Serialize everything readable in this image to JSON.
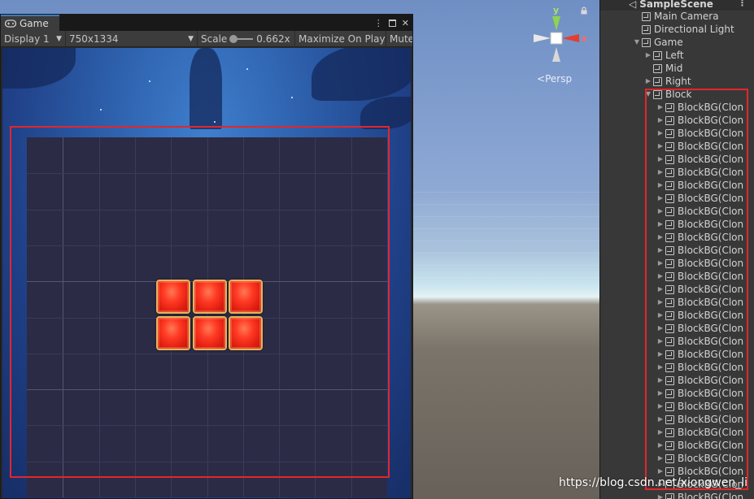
{
  "game_window": {
    "tab_label": "Game",
    "menu_dots": "⋮",
    "close_glyph": "✕",
    "toolbar": {
      "display": "Display 1",
      "resolution": "750x1334",
      "scale_label": "Scale",
      "scale_value": "0.662x",
      "maximize": "Maximize On Play",
      "mute": "Mute"
    }
  },
  "scene_view": {
    "persp_label": "Persp",
    "gizmo_y": "y",
    "gizmo_x": "x"
  },
  "hierarchy": {
    "scene_name": "SampleScene",
    "menu_dots": "⋮",
    "items": [
      {
        "label": "Main Camera",
        "depth": 1,
        "arrow": ""
      },
      {
        "label": "Directional Light",
        "depth": 1,
        "arrow": ""
      },
      {
        "label": "Game",
        "depth": 1,
        "arrow": "▼"
      },
      {
        "label": "Left",
        "depth": 2,
        "arrow": "▶"
      },
      {
        "label": "Mid",
        "depth": 2,
        "arrow": ""
      },
      {
        "label": "Right",
        "depth": 2,
        "arrow": "▶"
      },
      {
        "label": "Block",
        "depth": 2,
        "arrow": "▼"
      },
      {
        "label": "BlockBG(Clon",
        "depth": 3,
        "arrow": "▶"
      },
      {
        "label": "BlockBG(Clon",
        "depth": 3,
        "arrow": "▶"
      },
      {
        "label": "BlockBG(Clon",
        "depth": 3,
        "arrow": "▶"
      },
      {
        "label": "BlockBG(Clon",
        "depth": 3,
        "arrow": "▶"
      },
      {
        "label": "BlockBG(Clon",
        "depth": 3,
        "arrow": "▶"
      },
      {
        "label": "BlockBG(Clon",
        "depth": 3,
        "arrow": "▶"
      },
      {
        "label": "BlockBG(Clon",
        "depth": 3,
        "arrow": "▶"
      },
      {
        "label": "BlockBG(Clon",
        "depth": 3,
        "arrow": "▶"
      },
      {
        "label": "BlockBG(Clon",
        "depth": 3,
        "arrow": "▶"
      },
      {
        "label": "BlockBG(Clon",
        "depth": 3,
        "arrow": "▶"
      },
      {
        "label": "BlockBG(Clon",
        "depth": 3,
        "arrow": "▶"
      },
      {
        "label": "BlockBG(Clon",
        "depth": 3,
        "arrow": "▶"
      },
      {
        "label": "BlockBG(Clon",
        "depth": 3,
        "arrow": "▶"
      },
      {
        "label": "BlockBG(Clon",
        "depth": 3,
        "arrow": "▶"
      },
      {
        "label": "BlockBG(Clon",
        "depth": 3,
        "arrow": "▶"
      },
      {
        "label": "BlockBG(Clon",
        "depth": 3,
        "arrow": "▶"
      },
      {
        "label": "BlockBG(Clon",
        "depth": 3,
        "arrow": "▶"
      },
      {
        "label": "BlockBG(Clon",
        "depth": 3,
        "arrow": "▶"
      },
      {
        "label": "BlockBG(Clon",
        "depth": 3,
        "arrow": "▶"
      },
      {
        "label": "BlockBG(Clon",
        "depth": 3,
        "arrow": "▶"
      },
      {
        "label": "BlockBG(Clon",
        "depth": 3,
        "arrow": "▶"
      },
      {
        "label": "BlockBG(Clon",
        "depth": 3,
        "arrow": "▶"
      },
      {
        "label": "BlockBG(Clon",
        "depth": 3,
        "arrow": "▶"
      },
      {
        "label": "BlockBG(Clon",
        "depth": 3,
        "arrow": "▶"
      },
      {
        "label": "BlockBG(Clon",
        "depth": 3,
        "arrow": "▶"
      },
      {
        "label": "BlockBG(Clon",
        "depth": 3,
        "arrow": "▶"
      },
      {
        "label": "BlockBG(Clon",
        "depth": 3,
        "arrow": "▶"
      },
      {
        "label": "BlockBG(Clon",
        "depth": 3,
        "arrow": "▶"
      },
      {
        "label": "BlockBG(Clon",
        "depth": 3,
        "arrow": "▶"
      },
      {
        "label": "BlockBG(Clon",
        "depth": 3,
        "arrow": "▶"
      },
      {
        "label": "BlockBG(Clon",
        "depth": 3,
        "arrow": "▶"
      }
    ]
  },
  "board": {
    "rows": 10,
    "cols": 10,
    "blocks": [
      [
        4,
        4
      ],
      [
        5,
        4
      ],
      [
        6,
        4
      ],
      [
        4,
        5
      ],
      [
        5,
        5
      ],
      [
        6,
        5
      ]
    ],
    "block_color": "#ff3a24",
    "highlight_color": "#e3262b"
  },
  "watermark": "https://blog.csdn.net/xiongwen_li"
}
